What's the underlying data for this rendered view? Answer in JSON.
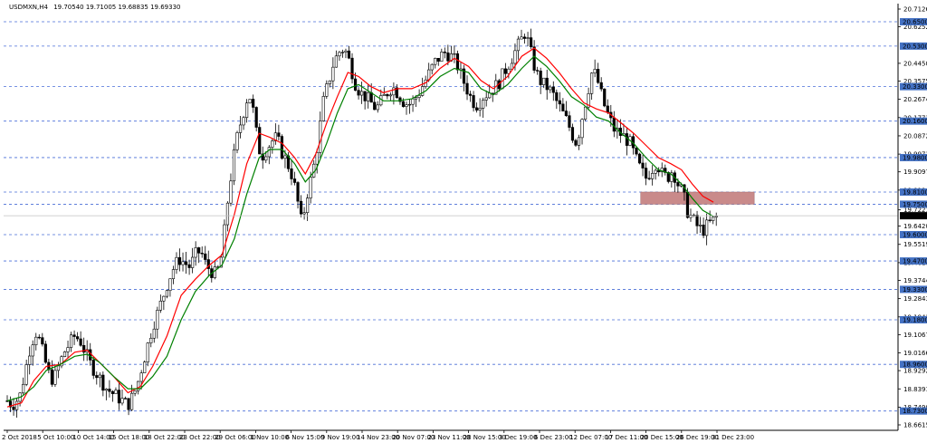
{
  "header": {
    "symbol": "USDMXN,H4",
    "ohlc": "19.70540 19.71005 19.68835 19.69330"
  },
  "chart_data": {
    "type": "line",
    "title": "",
    "instrument": "USDMXN",
    "timeframe": "H4",
    "ylim": [
      18.66155,
      20.71265
    ],
    "grid": false,
    "current_price": 19.6933,
    "price_ticks": [
      "20.71265",
      "20.62520",
      "20.44500",
      "20.35755",
      "20.26745",
      "20.17735",
      "20.08725",
      "19.99715",
      "19.90970",
      "19.81960",
      "19.72215",
      "19.64205",
      "19.55195",
      "19.46185",
      "19.37440",
      "19.28430",
      "19.19420",
      "19.10675",
      "19.01665",
      "18.92920",
      "18.83910",
      "18.74900",
      "18.66155"
    ],
    "levels": [
      20.65,
      20.53,
      20.33,
      20.16,
      19.98,
      19.81,
      19.75,
      19.6,
      19.47,
      19.33,
      19.18,
      18.96,
      18.73
    ],
    "level_labels": [
      "20.65000",
      "20.53000",
      "20.33000",
      "20.16000",
      "19.98000",
      "19.81000",
      "19.75000",
      "19.60000",
      "19.47000",
      "19.33000",
      "19.18000",
      "18.96000",
      "18.73000"
    ],
    "time_labels": [
      "2 Oct 2018",
      "5 Oct 10:00",
      "10 Oct 14:00",
      "15 Oct 18:00",
      "18 Oct 22:00",
      "23 Oct 22:00",
      "29 Oct 06:00",
      "1 Nov 10:00",
      "6 Nov 15:00",
      "9 Nov 19:00",
      "14 Nov 23:00",
      "20 Nov 07:00",
      "23 Nov 11:00",
      "28 Nov 15:00",
      "3 Dec 19:00",
      "6 Dec 23:00",
      "12 Dec 07:00",
      "17 Dec 11:00",
      "20 Dec 15:00",
      "26 Dec 19:00",
      "31 Dec 23:00"
    ],
    "time_label_values": [
      0,
      20,
      40,
      60,
      80,
      100,
      120,
      140,
      160,
      180,
      200,
      220,
      240,
      260,
      280,
      300,
      320,
      340,
      360,
      380,
      400
    ],
    "zone": {
      "x_from": 357,
      "x_to": 421,
      "y_low": 19.75,
      "y_high": 19.81,
      "color": "#c98a8a"
    },
    "price_path": [
      [
        0,
        18.78
      ],
      [
        3,
        18.76
      ],
      [
        7,
        18.8
      ],
      [
        10,
        18.92
      ],
      [
        13,
        19.05
      ],
      [
        16,
        19.12
      ],
      [
        18,
        19.08
      ],
      [
        20,
        19.02
      ],
      [
        23,
        18.92
      ],
      [
        26,
        18.88
      ],
      [
        29,
        18.95
      ],
      [
        32,
        19.02
      ],
      [
        35,
        19.06
      ],
      [
        38,
        19.1
      ],
      [
        41,
        19.08
      ],
      [
        44,
        19.02
      ],
      [
        47,
        18.96
      ],
      [
        50,
        18.92
      ],
      [
        53,
        18.88
      ],
      [
        56,
        18.84
      ],
      [
        59,
        18.82
      ],
      [
        62,
        18.8
      ],
      [
        65,
        18.78
      ],
      [
        68,
        18.76
      ],
      [
        70,
        18.79
      ],
      [
        73,
        18.85
      ],
      [
        76,
        18.95
      ],
      [
        79,
        19.05
      ],
      [
        82,
        19.15
      ],
      [
        85,
        19.22
      ],
      [
        88,
        19.3
      ],
      [
        91,
        19.38
      ],
      [
        94,
        19.44
      ],
      [
        97,
        19.48
      ],
      [
        100,
        19.46
      ],
      [
        103,
        19.44
      ],
      [
        106,
        19.5
      ],
      [
        109,
        19.52
      ],
      [
        112,
        19.45
      ],
      [
        115,
        19.42
      ],
      [
        118,
        19.4
      ],
      [
        121,
        19.5
      ],
      [
        124,
        19.75
      ],
      [
        127,
        19.95
      ],
      [
        130,
        20.1
      ],
      [
        133,
        20.2
      ],
      [
        136,
        20.3
      ],
      [
        138,
        20.25
      ],
      [
        140,
        20.12
      ],
      [
        143,
        19.98
      ],
      [
        146,
        20.02
      ],
      [
        149,
        20.06
      ],
      [
        152,
        20.08
      ],
      [
        155,
        20.0
      ],
      [
        158,
        19.95
      ],
      [
        161,
        19.88
      ],
      [
        164,
        19.75
      ],
      [
        166,
        19.65
      ],
      [
        169,
        19.8
      ],
      [
        172,
        19.9
      ],
      [
        175,
        20.05
      ],
      [
        178,
        20.25
      ],
      [
        181,
        20.35
      ],
      [
        184,
        20.45
      ],
      [
        187,
        20.5
      ],
      [
        190,
        20.52
      ],
      [
        193,
        20.45
      ],
      [
        196,
        20.35
      ],
      [
        199,
        20.3
      ],
      [
        202,
        20.28
      ],
      [
        205,
        20.25
      ],
      [
        208,
        20.22
      ],
      [
        211,
        20.26
      ],
      [
        214,
        20.3
      ],
      [
        217,
        20.33
      ],
      [
        220,
        20.3
      ],
      [
        223,
        20.26
      ],
      [
        226,
        20.24
      ],
      [
        229,
        20.26
      ],
      [
        232,
        20.3
      ],
      [
        235,
        20.35
      ],
      [
        238,
        20.4
      ],
      [
        241,
        20.45
      ],
      [
        244,
        20.48
      ],
      [
        247,
        20.5
      ],
      [
        250,
        20.48
      ],
      [
        253,
        20.45
      ],
      [
        256,
        20.38
      ],
      [
        259,
        20.32
      ],
      [
        262,
        20.26
      ],
      [
        265,
        20.24
      ],
      [
        268,
        20.28
      ],
      [
        271,
        20.3
      ],
      [
        274,
        20.32
      ],
      [
        277,
        20.35
      ],
      [
        280,
        20.4
      ],
      [
        283,
        20.45
      ],
      [
        286,
        20.5
      ],
      [
        289,
        20.55
      ],
      [
        292,
        20.6
      ],
      [
        295,
        20.5
      ],
      [
        298,
        20.4
      ],
      [
        301,
        20.35
      ],
      [
        304,
        20.33
      ],
      [
        307,
        20.3
      ],
      [
        310,
        20.25
      ],
      [
        313,
        20.2
      ],
      [
        316,
        20.15
      ],
      [
        319,
        20.08
      ],
      [
        321,
        20.05
      ],
      [
        324,
        20.18
      ],
      [
        327,
        20.3
      ],
      [
        330,
        20.42
      ],
      [
        333,
        20.35
      ],
      [
        336,
        20.25
      ],
      [
        339,
        20.18
      ],
      [
        342,
        20.12
      ],
      [
        345,
        20.1
      ],
      [
        348,
        20.08
      ],
      [
        351,
        20.05
      ],
      [
        354,
        19.98
      ],
      [
        357,
        19.92
      ],
      [
        360,
        19.88
      ],
      [
        363,
        19.92
      ],
      [
        366,
        19.96
      ],
      [
        369,
        19.9
      ],
      [
        372,
        19.88
      ],
      [
        375,
        19.92
      ],
      [
        378,
        19.85
      ],
      [
        381,
        19.8
      ],
      [
        383,
        19.72
      ],
      [
        386,
        19.68
      ],
      [
        389,
        19.64
      ],
      [
        392,
        19.62
      ],
      [
        395,
        19.65
      ],
      [
        398,
        19.67
      ],
      [
        400,
        19.69
      ]
    ],
    "series": [
      {
        "name": "",
        "color": "#ff0000",
        "values": [
          [
            0,
            18.75
          ],
          [
            8,
            18.77
          ],
          [
            15,
            18.88
          ],
          [
            22,
            18.95
          ],
          [
            30,
            18.96
          ],
          [
            38,
            19.02
          ],
          [
            45,
            19.03
          ],
          [
            52,
            18.97
          ],
          [
            60,
            18.9
          ],
          [
            68,
            18.82
          ],
          [
            75,
            18.85
          ],
          [
            82,
            18.95
          ],
          [
            90,
            19.1
          ],
          [
            98,
            19.3
          ],
          [
            106,
            19.38
          ],
          [
            114,
            19.45
          ],
          [
            121,
            19.5
          ],
          [
            128,
            19.7
          ],
          [
            135,
            19.95
          ],
          [
            142,
            20.1
          ],
          [
            148,
            20.08
          ],
          [
            155,
            20.05
          ],
          [
            162,
            19.98
          ],
          [
            168,
            19.9
          ],
          [
            174,
            20.0
          ],
          [
            180,
            20.15
          ],
          [
            186,
            20.28
          ],
          [
            192,
            20.4
          ],
          [
            198,
            20.38
          ],
          [
            205,
            20.33
          ],
          [
            212,
            20.3
          ],
          [
            220,
            20.32
          ],
          [
            228,
            20.32
          ],
          [
            236,
            20.35
          ],
          [
            244,
            20.42
          ],
          [
            252,
            20.47
          ],
          [
            260,
            20.43
          ],
          [
            267,
            20.36
          ],
          [
            274,
            20.32
          ],
          [
            282,
            20.38
          ],
          [
            290,
            20.48
          ],
          [
            297,
            20.52
          ],
          [
            304,
            20.47
          ],
          [
            311,
            20.4
          ],
          [
            318,
            20.32
          ],
          [
            325,
            20.25
          ],
          [
            332,
            20.22
          ],
          [
            339,
            20.2
          ],
          [
            346,
            20.15
          ],
          [
            353,
            20.1
          ],
          [
            360,
            20.04
          ],
          [
            367,
            19.98
          ],
          [
            374,
            19.95
          ],
          [
            380,
            19.92
          ],
          [
            386,
            19.85
          ],
          [
            392,
            19.79
          ],
          [
            398,
            19.76
          ]
        ]
      },
      {
        "name": "",
        "color": "#008000",
        "values": [
          [
            0,
            18.78
          ],
          [
            8,
            18.8
          ],
          [
            15,
            18.85
          ],
          [
            22,
            18.93
          ],
          [
            30,
            18.96
          ],
          [
            38,
            19.0
          ],
          [
            45,
            19.01
          ],
          [
            52,
            18.97
          ],
          [
            60,
            18.9
          ],
          [
            68,
            18.84
          ],
          [
            75,
            18.84
          ],
          [
            82,
            18.9
          ],
          [
            90,
            19.0
          ],
          [
            98,
            19.18
          ],
          [
            106,
            19.32
          ],
          [
            114,
            19.4
          ],
          [
            121,
            19.45
          ],
          [
            128,
            19.58
          ],
          [
            135,
            19.8
          ],
          [
            142,
            19.98
          ],
          [
            148,
            20.02
          ],
          [
            155,
            20.02
          ],
          [
            162,
            19.95
          ],
          [
            168,
            19.86
          ],
          [
            174,
            19.92
          ],
          [
            180,
            20.05
          ],
          [
            186,
            20.2
          ],
          [
            192,
            20.32
          ],
          [
            198,
            20.34
          ],
          [
            205,
            20.3
          ],
          [
            212,
            20.26
          ],
          [
            220,
            20.26
          ],
          [
            228,
            20.27
          ],
          [
            236,
            20.31
          ],
          [
            244,
            20.38
          ],
          [
            252,
            20.42
          ],
          [
            260,
            20.4
          ],
          [
            267,
            20.32
          ],
          [
            274,
            20.29
          ],
          [
            282,
            20.34
          ],
          [
            290,
            20.42
          ],
          [
            297,
            20.48
          ],
          [
            304,
            20.43
          ],
          [
            311,
            20.36
          ],
          [
            318,
            20.28
          ],
          [
            325,
            20.24
          ],
          [
            332,
            20.18
          ],
          [
            339,
            20.16
          ],
          [
            346,
            20.1
          ],
          [
            353,
            20.05
          ],
          [
            360,
            19.98
          ],
          [
            367,
            19.92
          ],
          [
            374,
            19.9
          ],
          [
            380,
            19.85
          ],
          [
            386,
            19.78
          ],
          [
            392,
            19.72
          ],
          [
            398,
            19.69
          ]
        ]
      }
    ]
  }
}
